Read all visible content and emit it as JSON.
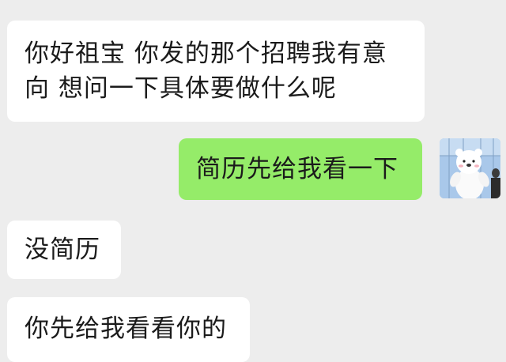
{
  "messages": [
    {
      "side": "in",
      "text": "你好祖宝 你发的那个招聘我有意\n向 想问一下具体要做什么呢"
    },
    {
      "side": "out",
      "text": "简历先给我看一下"
    },
    {
      "side": "in",
      "text": "没简历"
    },
    {
      "side": "in",
      "text": "你先给我看看你的"
    }
  ],
  "avatar": {
    "icon": "bear-mascot-avatar-icon"
  },
  "colors": {
    "background": "#ededed",
    "incoming_bubble": "#ffffff",
    "outgoing_bubble": "#95ec69",
    "text": "#1b1b1b"
  }
}
